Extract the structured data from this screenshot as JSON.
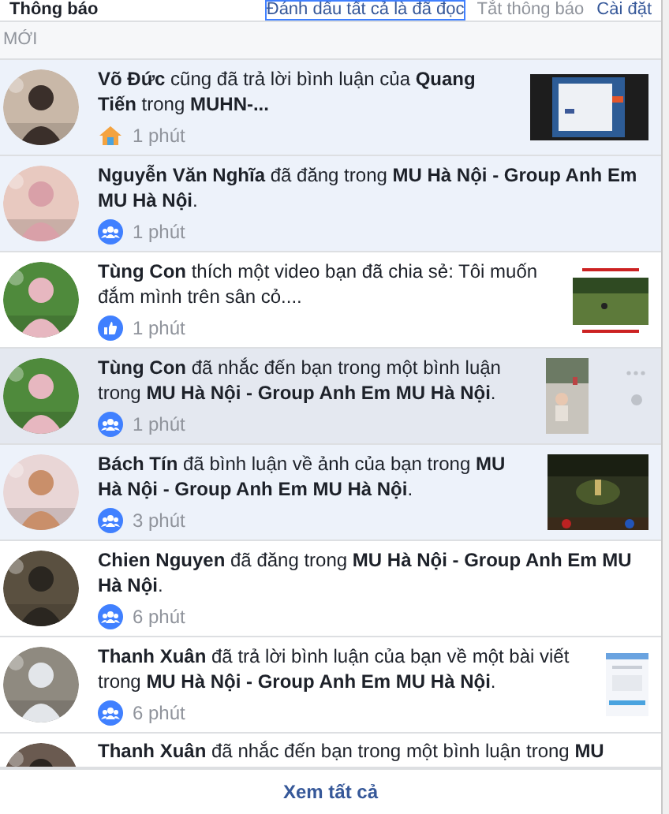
{
  "header": {
    "title": "Thông báo",
    "mark_all_read": "Đánh dấu tất cả là đã đọc",
    "mute": "Tắt thông báo",
    "settings": "Cài đặt"
  },
  "section_label": "MỚI",
  "notifications": [
    {
      "text": "**Võ Đức** cũng đã trả lời bình luận của **Quang Tiến** trong **MUHN-...**",
      "kind": "home",
      "time": "1 phút",
      "unread": true,
      "hovered": false
    },
    {
      "text": "**Nguyễn Văn Nghĩa** đã đăng trong **MU Hà Nội - Group Anh Em MU Hà Nội**.",
      "kind": "group",
      "time": "1 phút",
      "unread": true,
      "hovered": false
    },
    {
      "text": "**Tùng Con** thích một video bạn đã chia sẻ: Tôi muốn đắm mình trên sân cỏ....",
      "kind": "like",
      "time": "1 phút",
      "unread": false,
      "hovered": false
    },
    {
      "text": "**Tùng Con** đã nhắc đến bạn trong một bình luận trong **MU Hà Nội - Group Anh Em MU Hà Nội**.",
      "kind": "group",
      "time": "1 phút",
      "unread": true,
      "hovered": true
    },
    {
      "text": "**Bách Tín** đã bình luận về ảnh của bạn trong **MU Hà Nội - Group Anh Em MU Hà Nội**.",
      "kind": "group",
      "time": "3 phút",
      "unread": true,
      "hovered": false
    },
    {
      "text": "**Chien Nguyen** đã đăng trong **MU Hà Nội - Group Anh Em MU Hà Nội**.",
      "kind": "group",
      "time": "6 phút",
      "unread": false,
      "hovered": false
    },
    {
      "text": "**Thanh Xuân** đã trả lời bình luận của bạn về một bài viết trong **MU Hà Nội - Group Anh Em MU Hà Nội**.",
      "kind": "group",
      "time": "6 phút",
      "unread": false,
      "hovered": false
    },
    {
      "text": "**Thanh Xuân** đã nhắc đến bạn trong một bình luận trong **MU**",
      "unread": false,
      "hovered": false
    }
  ],
  "footer": "Xem tất cả"
}
